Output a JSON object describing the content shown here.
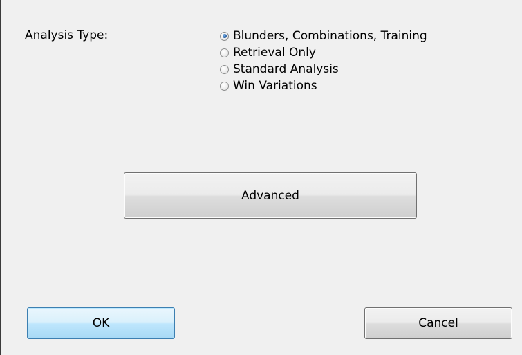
{
  "dialog": {
    "analysis_type_label": "Analysis Type:",
    "options": [
      {
        "label": "Blunders, Combinations, Training",
        "checked": true
      },
      {
        "label": "Retrieval Only",
        "checked": false
      },
      {
        "label": "Standard Analysis",
        "checked": false
      },
      {
        "label": "Win Variations",
        "checked": false
      }
    ],
    "advanced_label": "Advanced",
    "ok_label": "OK",
    "cancel_label": "Cancel"
  },
  "colors": {
    "dialog_background": "#f0f0f0",
    "left_border": "#3b3b3b",
    "ok_button_border": "#3c7fb1",
    "radio_selected_dot": "#2a63a8"
  }
}
